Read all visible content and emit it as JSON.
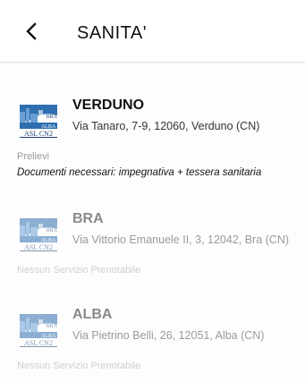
{
  "header": {
    "title": "SANITA'",
    "back_icon": "chevron-left-icon"
  },
  "logo": {
    "line1": "BRA",
    "line2": "ALBA",
    "line3": "ASL CN2"
  },
  "sites": [
    {
      "name": "VERDUNO",
      "address": "Via Tanaro, 7-9, 12060, Verduno (CN)",
      "service": "Prelievi",
      "requirements": "Documenti necessari: impegnativa + tessera sanitaria",
      "enabled": true
    },
    {
      "name": "BRA",
      "address": "Via Vittorio Emanuele II, 3, 12042, Bra (CN)",
      "service": "Nessun Servizio Prenotabile",
      "enabled": false
    },
    {
      "name": "ALBA",
      "address": "Via Pietrino Belli, 26, 12051, Alba (CN)",
      "service": "Nessun Servizio Prenotabile",
      "enabled": false
    }
  ],
  "colors": {
    "logo_blue": "#2f6fb0",
    "logo_dark": "#1f3f7a"
  }
}
